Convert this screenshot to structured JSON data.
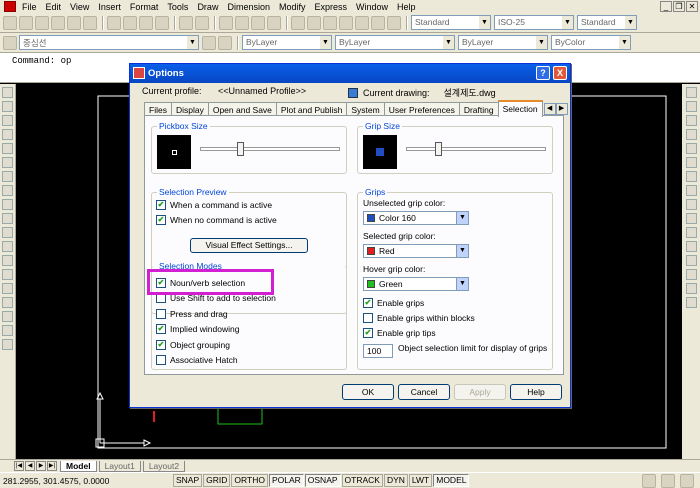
{
  "menu": [
    "File",
    "Edit",
    "View",
    "Insert",
    "Format",
    "Tools",
    "Draw",
    "Dimension",
    "Modify",
    "Express",
    "Window",
    "Help"
  ],
  "toolbar": {
    "text_style": "Standard",
    "dim_style": "ISO-25",
    "table_style": "Standard",
    "layer": "중심선",
    "color": "ByLayer",
    "linetype": "ByLayer",
    "lineweight": "ByLayer",
    "plotstyle": "ByColor"
  },
  "command_line": "Command: op",
  "dialog": {
    "title": "Options",
    "help_btn": "?",
    "close_btn": "X",
    "current_profile_label": "Current profile:",
    "current_profile_value": "<<Unnamed Profile>>",
    "current_drawing_label": "Current drawing:",
    "current_drawing_value": "설계제도.dwg",
    "tabs": [
      "Files",
      "Display",
      "Open and Save",
      "Plot and Publish",
      "System",
      "User Preferences",
      "Drafting",
      "Selection"
    ],
    "active_tab": "Selection",
    "pickbox": {
      "label": "Pickbox Size",
      "level": 0.28
    },
    "grip_size": {
      "label": "Grip Size",
      "level": 0.22
    },
    "selection_preview": {
      "label": "Selection Preview",
      "items": [
        {
          "label": "When a command is active",
          "checked": true
        },
        {
          "label": "When no command is active",
          "checked": true
        }
      ],
      "button": "Visual Effect Settings..."
    },
    "selection_modes": {
      "label": "Selection Modes",
      "items": [
        {
          "label": "Noun/verb selection",
          "checked": true
        },
        {
          "label": "Use Shift to add to selection",
          "checked": false
        },
        {
          "label": "Press and drag",
          "checked": false
        },
        {
          "label": "Implied windowing",
          "checked": true
        },
        {
          "label": "Object grouping",
          "checked": true
        },
        {
          "label": "Associative Hatch",
          "checked": false
        }
      ]
    },
    "grips": {
      "label": "Grips",
      "unselected_label": "Unselected grip color:",
      "unselected_value": "Color 160",
      "unselected_color": "#1f4fbf",
      "selected_label": "Selected grip color:",
      "selected_value": "Red",
      "selected_color": "#e02020",
      "hover_label": "Hover grip color:",
      "hover_value": "Green",
      "hover_color": "#20c020",
      "items": [
        {
          "label": "Enable grips",
          "checked": true
        },
        {
          "label": "Enable grips within blocks",
          "checked": false
        },
        {
          "label": "Enable grip tips",
          "checked": true
        }
      ],
      "limit_value": "100",
      "limit_label": "Object selection limit for display of grips"
    },
    "ok": "OK",
    "cancel": "Cancel",
    "apply": "Apply",
    "help": "Help"
  },
  "layout_tabs": [
    "Model",
    "Layout1",
    "Layout2"
  ],
  "status": {
    "coords": "281.2955, 301.4575, 0.0000",
    "buttons": [
      "SNAP",
      "GRID",
      "ORTHO",
      "POLAR",
      "OSNAP",
      "OTRACK",
      "DYN",
      "LWT",
      "MODEL"
    ],
    "on": [
      "POLAR",
      "OSNAP",
      "MODEL"
    ]
  }
}
